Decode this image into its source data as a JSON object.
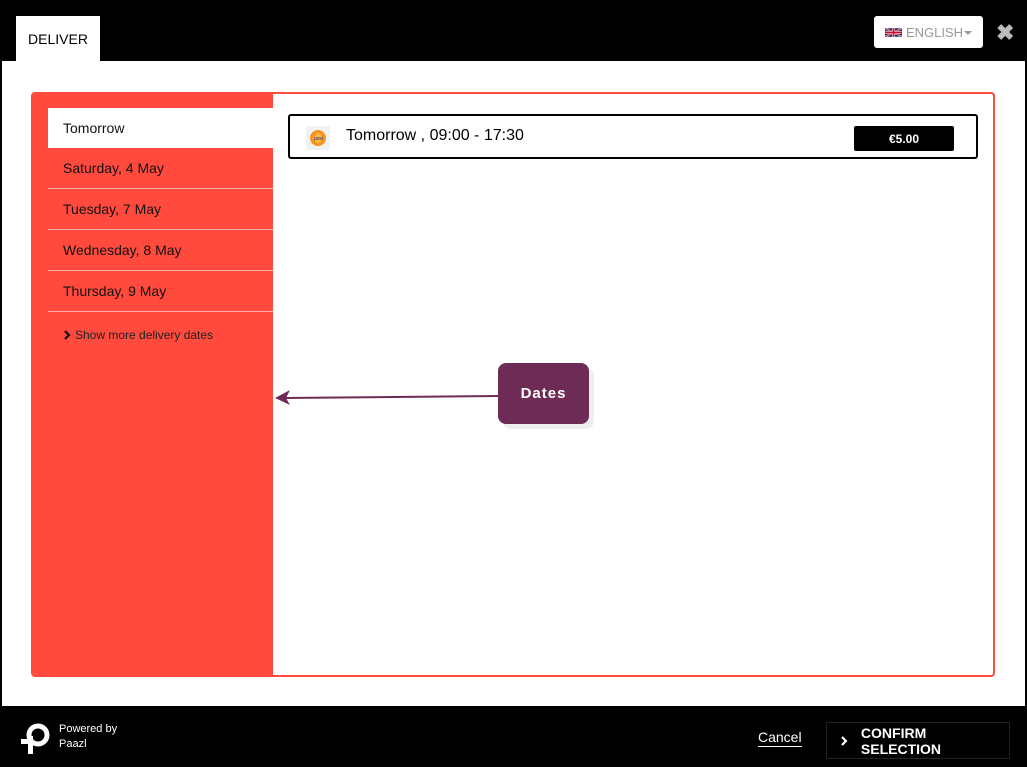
{
  "header": {
    "active_tab": "DELIVER",
    "language": "ENGLISH",
    "close_glyph": "✖"
  },
  "sidebar": {
    "dates": [
      {
        "label": "Tomorrow",
        "active": true
      },
      {
        "label": "Saturday, 4 May",
        "active": false
      },
      {
        "label": "Tuesday, 7 May",
        "active": false
      },
      {
        "label": "Wednesday, 8 May",
        "active": false
      },
      {
        "label": "Thursday, 9 May",
        "active": false
      }
    ],
    "show_more": "Show more delivery dates"
  },
  "options": [
    {
      "label": "Tomorrow , 09:00 - 17:30",
      "price": "€5.00",
      "carrier_icon": "postnl-logo-icon"
    }
  ],
  "annotation": {
    "label": "Dates"
  },
  "footer": {
    "powered_line1": "Powered by",
    "powered_line2": "Paazl",
    "cancel": "Cancel",
    "confirm": "CONFIRM SELECTION"
  },
  "colors": {
    "accent": "#ff4a3d",
    "annotation": "#6e2b55",
    "dark": "#000000"
  }
}
